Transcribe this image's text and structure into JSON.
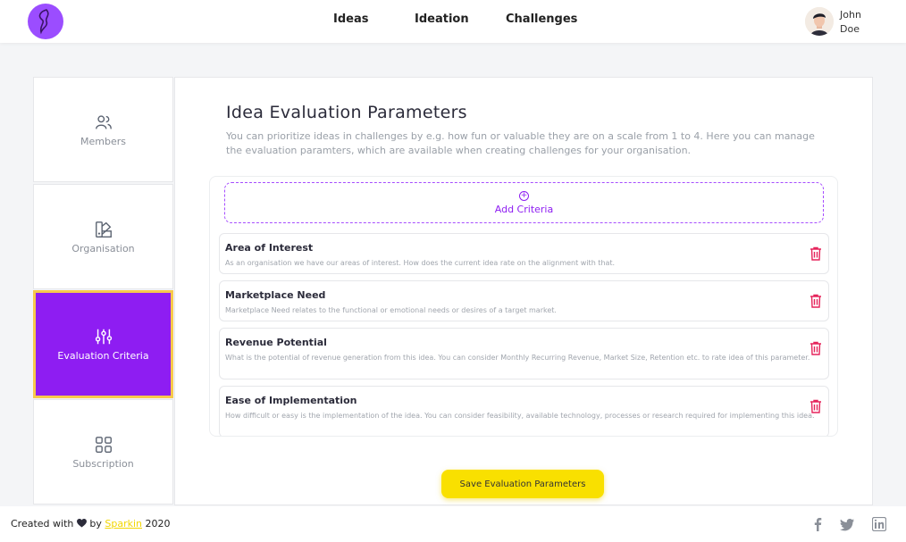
{
  "header": {
    "nav": [
      "Ideas",
      "Ideation",
      "Challenges"
    ],
    "user_first": "John",
    "user_last": "Doe"
  },
  "sidebar": {
    "items": [
      {
        "label": "Members",
        "icon": "users-icon"
      },
      {
        "label": "Organisation",
        "icon": "palette-icon"
      },
      {
        "label": "Evaluation Criteria",
        "icon": "sliders-icon",
        "active": true
      },
      {
        "label": "Subscription",
        "icon": "grid-icon"
      }
    ]
  },
  "main": {
    "title": "Idea Evaluation Parameters",
    "description": "You can prioritize ideas in challenges by e.g. how fun or valuable they are on a scale from 1 to 4. Here you can manage the evaluation paramters, which are available when creating challenges for your organisation.",
    "add_label": "Add Criteria",
    "criteria": [
      {
        "name": "Area of Interest",
        "description": "As an organisation we have our areas of interest. How does the current idea rate on the alignment with that."
      },
      {
        "name": "Marketplace Need",
        "description": "Marketplace Need relates to the functional or emotional needs or desires of a target market."
      },
      {
        "name": "Revenue Potential",
        "description": "What is the potential of revenue generation from this idea. You can consider Monthly Recurring Revenue, Market Size, Retention etc. to rate idea of this parameter."
      },
      {
        "name": "Ease of Implementation",
        "description": "How difficult or easy is the implementation of the idea. You can consider feasibility, available technology, processes or research required for implementing this idea."
      }
    ],
    "save_label": "Save Evaluation Parameters"
  },
  "footer": {
    "prefix": "Created with",
    "by": "by",
    "brand": "Sparkin",
    "year": "2020"
  },
  "colors": {
    "accent": "#8e1df2",
    "highlight": "#f9e000",
    "danger": "#e5245b"
  }
}
